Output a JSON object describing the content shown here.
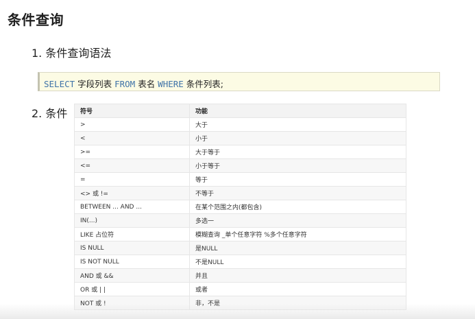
{
  "page": {
    "title": "条件查询"
  },
  "sections": [
    {
      "heading": "1. 条件查询语法"
    },
    {
      "heading": "2. 条件"
    }
  ],
  "syntax": {
    "select_kw": "SELECT",
    "field_list": " 字段列表 ",
    "from_kw": "FROM",
    "table_name": " 表名 ",
    "where_kw": "WHERE",
    "condition_list": " 条件列表;"
  },
  "condition_table": {
    "headers": [
      "符号",
      "功能"
    ],
    "rows": [
      [
        ">",
        "大于"
      ],
      [
        "<",
        "小于"
      ],
      [
        ">=",
        "大于等于"
      ],
      [
        "<=",
        "小于等于"
      ],
      [
        "=",
        "等于"
      ],
      [
        "<> 或 !=",
        "不等于"
      ],
      [
        "BETWEEN ... AND ...",
        "在某个范围之内(都包含)"
      ],
      [
        "IN(...)",
        "多选一"
      ],
      [
        "LIKE 占位符",
        "模糊查询 _单个任意字符 %多个任意字符"
      ],
      [
        "IS NULL",
        "是NULL"
      ],
      [
        "IS NOT NULL",
        "不是NULL"
      ],
      [
        "AND 或 &&",
        "并且"
      ],
      [
        "OR 或 | |",
        "或者"
      ],
      [
        "NOT 或 !",
        "非，不是"
      ]
    ]
  },
  "colors": {
    "keyword": "#3f73a8",
    "code_background": "#fcfbe4",
    "table_header_background": "#f3f3f3"
  }
}
